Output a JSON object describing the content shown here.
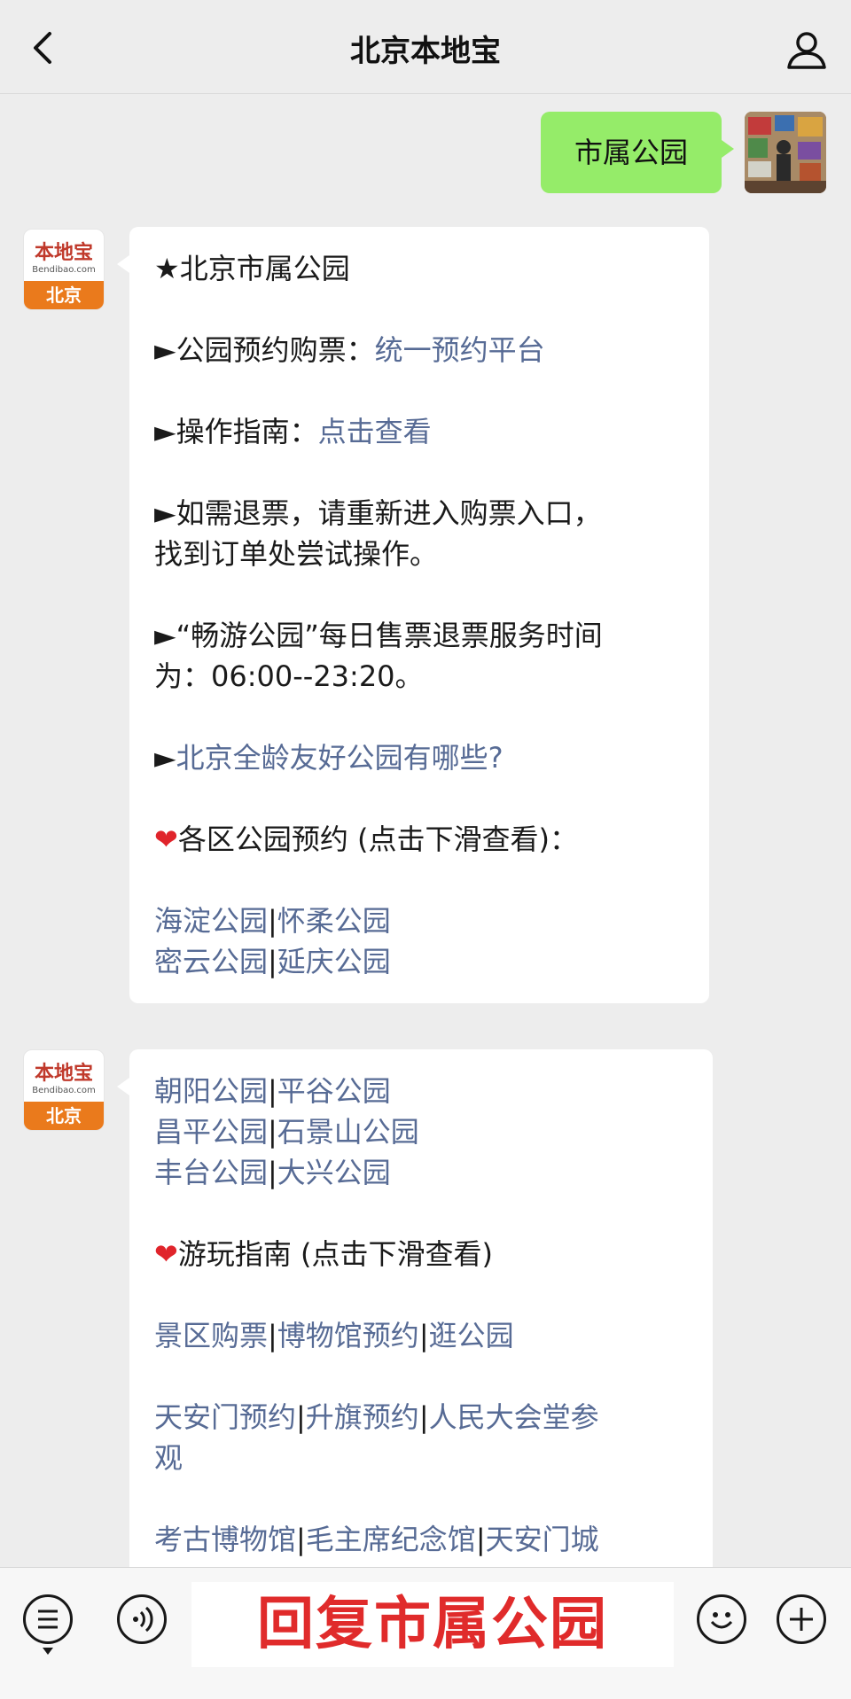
{
  "header": {
    "title": "北京本地宝"
  },
  "outgoing": {
    "text": "市属公园"
  },
  "bot": {
    "logo_top": "本地宝",
    "logo_mid": "Bendibao.com",
    "logo_bottom": "北京"
  },
  "msg1": {
    "title": "★北京市属公园",
    "booking_prefix": "►公园预约购票：",
    "booking_link": "统一预约平台",
    "guide_prefix": "►操作指南：",
    "guide_link": "点击查看",
    "refund_line1": "►如需退票，请重新进入购票入口，",
    "refund_line2": "找到订单处尝试操作。",
    "hours_line1": "►“畅游公园”每日售票退票服务时间",
    "hours_line2": "为：06:00--23:20。",
    "friendly_prefix": "►",
    "friendly_link": "北京全龄友好公园有哪些?",
    "district_heading": "各区公园预约 (点击下滑查看)：",
    "heart": "❤",
    "links_row1": [
      "海淀公园",
      "怀柔公园"
    ],
    "links_row2": [
      "密云公园",
      "延庆公园"
    ]
  },
  "msg2": {
    "links_row1": [
      "朝阳公园",
      "平谷公园"
    ],
    "links_row2": [
      "昌平公园",
      "石景山公园"
    ],
    "links_row3": [
      "丰台公园",
      "大兴公园"
    ],
    "heart": "❤",
    "guide_heading": "游玩指南 (点击下滑查看)",
    "guide_row1": [
      "景区购票",
      "博物馆预约",
      "逛公园"
    ],
    "guide_row2": [
      "天安门预约",
      "升旗预约",
      "人民大会堂参"
    ],
    "guide_row2_cont": "观",
    "guide_row3": [
      "考古博物馆",
      "毛主席纪念馆",
      "天安门城"
    ]
  },
  "bottom_bar": {
    "reply_text": "回复市属公园"
  },
  "colors": {
    "link": "#576b95",
    "bubble_out": "#95ec69",
    "accent_red": "#e02b2b",
    "logo_orange": "#ea7a1c"
  }
}
